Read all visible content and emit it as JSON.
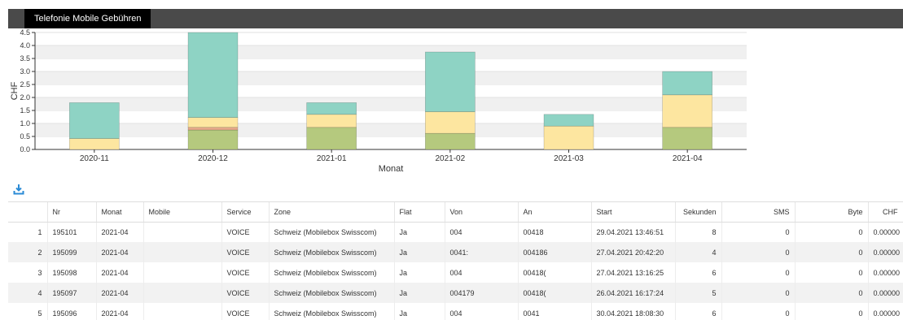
{
  "tab": {
    "title": "Telefonie Mobile Gebühren"
  },
  "chart_data": {
    "type": "bar",
    "stacked": true,
    "categories": [
      "2020-11",
      "2020-12",
      "2021-01",
      "2021-02",
      "2021-03",
      "2021-04"
    ],
    "series": [
      {
        "color": "#b5c97e",
        "values": [
          0,
          0.75,
          0.85,
          0.62,
          0,
          0.85
        ]
      },
      {
        "color": "#e8ab8c",
        "values": [
          0,
          0.1,
          0,
          0,
          0,
          0
        ]
      },
      {
        "color": "#fde6a0",
        "values": [
          0.42,
          0.38,
          0.5,
          0.83,
          0.9,
          1.25
        ]
      },
      {
        "color": "#8ed3c4",
        "values": [
          1.38,
          3.27,
          0.45,
          2.3,
          0.45,
          0.9
        ]
      }
    ],
    "ylim": [
      0,
      4.5
    ],
    "yticks": [
      "0.0",
      "0.5",
      "1.0",
      "1.5",
      "2.0",
      "2.5",
      "3.0",
      "3.5",
      "4.0",
      "4.5"
    ],
    "xlabel": "Monat",
    "ylabel": "CHF",
    "grid": true
  },
  "toolbar": {
    "download_icon": "download-icon"
  },
  "table": {
    "columns": [
      "",
      "Nr",
      "Monat",
      "Mobile",
      "Service",
      "Zone",
      "Flat",
      "Von",
      "An",
      "Start",
      "Sekunden",
      "SMS",
      "Byte",
      "CHF"
    ],
    "rows": [
      [
        "1",
        "195101",
        "2021-04",
        "",
        "VOICE",
        "Schweiz (Mobilebox Swisscom)",
        "Ja",
        "004",
        "00418",
        "29.04.2021 13:46:51",
        "8",
        "0",
        "0",
        "0.00000"
      ],
      [
        "2",
        "195099",
        "2021-04",
        "",
        "VOICE",
        "Schweiz (Mobilebox Swisscom)",
        "Ja",
        "0041:",
        "004186",
        "27.04.2021 20:42:20",
        "4",
        "0",
        "0",
        "0.00000"
      ],
      [
        "3",
        "195098",
        "2021-04",
        "",
        "VOICE",
        "Schweiz (Mobilebox Swisscom)",
        "Ja",
        "004",
        "00418(",
        "27.04.2021 13:16:25",
        "6",
        "0",
        "0",
        "0.00000"
      ],
      [
        "4",
        "195097",
        "2021-04",
        "",
        "VOICE",
        "Schweiz (Mobilebox Swisscom)",
        "Ja",
        "004179",
        "00418(",
        "26.04.2021 16:17:24",
        "5",
        "0",
        "0",
        "0.00000"
      ],
      [
        "5",
        "195096",
        "2021-04",
        "",
        "VOICE",
        "Schweiz (Mobilebox Swisscom)",
        "Ja",
        "004",
        "0041",
        "30.04.2021 18:08:30",
        "6",
        "0",
        "0",
        "0.00000"
      ]
    ]
  }
}
